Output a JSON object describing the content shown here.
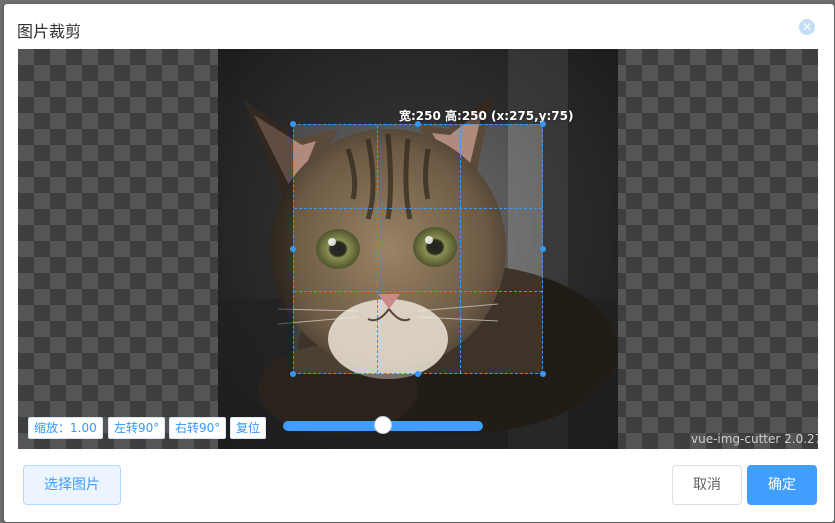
{
  "dialog": {
    "title": "图片裁剪",
    "close_icon": "close-icon"
  },
  "cropper": {
    "crop_info": "宽:250 高:250 (x:275,y:75)",
    "toolbar": {
      "zoom_label": "缩放：1.00",
      "rotate_left_label": "左转90°",
      "rotate_right_label": "右转90°",
      "reset_label": "复位"
    },
    "zoom_slider_value": 0.5,
    "version": "vue-img-cutter 2.0.27"
  },
  "footer": {
    "choose_label": "选择图片",
    "cancel_label": "取消",
    "confirm_label": "确定"
  },
  "colors": {
    "accent": "#409eff",
    "crop_border": "#3399ff"
  }
}
